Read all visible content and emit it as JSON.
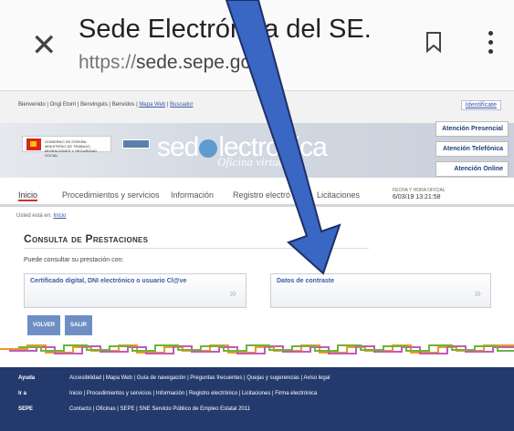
{
  "browser": {
    "title": "Sede Electrónica del SE...",
    "url_prefix": "https://",
    "url_host": "sede.sepe.gob."
  },
  "topbar": {
    "links": "Bienvenido | Ongi Etorri | Benvinguts | Benvidos |",
    "mapa_web": "Mapa Web",
    "buscador": "Buscador",
    "identificate": "Identifícate"
  },
  "banner": {
    "gov_text": "GOBIERNO DE ESPAÑA · MINISTERIO DE TRABAJO, MIGRACIONES Y SEGURIDAD SOCIAL",
    "logo_a": "sed",
    "logo_b": "lectrónica",
    "oficina": "Oficina virtual",
    "attention": [
      "Atención Presencial",
      "Atención Telefónica",
      "Atención Online"
    ]
  },
  "nav": {
    "tabs": [
      "Inicio",
      "Procedimientos y servicios",
      "Información",
      "Registro electró",
      "Licitaciones"
    ],
    "date_label": "FECHA Y HORA OFICIAL",
    "date_value": "6/03/19   13:21:58"
  },
  "crumb": {
    "prefix": "Usted está en:",
    "link": "Inicio"
  },
  "content": {
    "heading": "Consulta de Prestaciones",
    "intro": "Puede consultar su prestación con:",
    "option_1": "Certificado digital, DNI electrónico o usuario Cl@ve",
    "option_2": "Datos de contraste",
    "arrow_glyph": "»",
    "volver": "VOLVER",
    "salir": "SALIR"
  },
  "footer": {
    "rows": [
      {
        "key": "Ayuda",
        "value": "Accesibilidad | Mapa Web | Guía de navegación | Preguntas frecuentes | Quejas y sugerencias | Aviso legal"
      },
      {
        "key": "Ir a",
        "value": "Inicio | Procedimientos y servicios | Información | Registro electrónico | Licitaciones | Firma electrónica"
      },
      {
        "key": "SEPE",
        "value": "Contacto | Oficinas | SEPE | SNE Servicio Público de Empleo Estatal 2011"
      }
    ]
  },
  "colors": {
    "arrow": "#3a66c4",
    "footer": "#243a6c",
    "link": "#3a58a8",
    "button": "#6f8fc4"
  }
}
